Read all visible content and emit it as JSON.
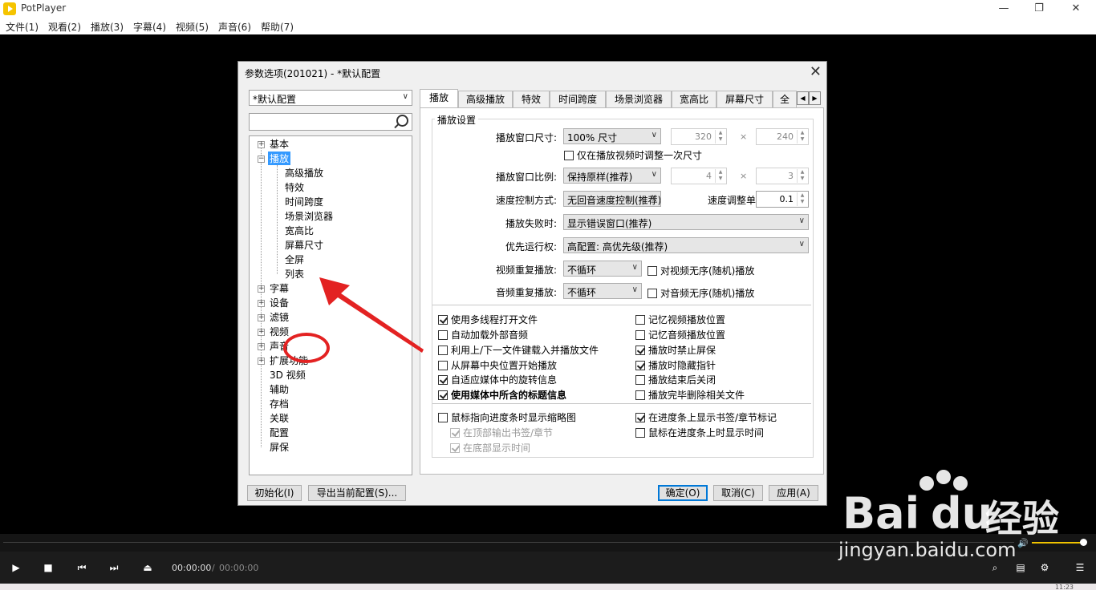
{
  "app": {
    "title": "PotPlayer",
    "menus": [
      "文件(1)",
      "观看(2)",
      "播放(3)",
      "字幕(4)",
      "视频(5)",
      "声音(6)",
      "帮助(7)"
    ]
  },
  "dialog": {
    "title": "参数选项(201021) - *默认配置",
    "profile_value": "*默认配置",
    "tree": {
      "basic": "基本",
      "playback": "播放",
      "children": [
        "高级播放",
        "特效",
        "时间跨度",
        "场景浏览器",
        "宽高比",
        "屏幕尺寸",
        "全屏",
        "列表"
      ],
      "after": [
        "字幕",
        "设备",
        "滤镜",
        "视频",
        "声音",
        "扩展功能"
      ],
      "plain": [
        "3D 视频",
        "辅助",
        "存档",
        "关联",
        "配置",
        "屏保"
      ]
    },
    "tabs": [
      "播放",
      "高级播放",
      "特效",
      "时间跨度",
      "场景浏览器",
      "宽高比",
      "屏幕尺寸",
      "全"
    ],
    "group_title": "播放设置",
    "window_size": {
      "label": "播放窗口尺寸:",
      "value": "100% 尺寸",
      "w": "320",
      "h": "240",
      "x": "×"
    },
    "resize_once": "仅在播放视频时调整一次尺寸",
    "window_ratio": {
      "label": "播放窗口比例:",
      "value": "保持原样(推荐)",
      "a": "4",
      "b": "3"
    },
    "speed_mode": {
      "label": "速度控制方式:",
      "value": "无回音速度控制(推荐)"
    },
    "speed_unit": {
      "label": "速度调整单位:",
      "value": "0.1"
    },
    "fail": {
      "label": "播放失败时:",
      "value": "显示错误窗口(推荐)"
    },
    "priority": {
      "label": "优先运行权:",
      "value": "高配置: 高优先级(推荐)"
    },
    "video_repeat": {
      "label": "视频重复播放:",
      "value": "不循环",
      "shuffle": "对视频无序(随机)播放"
    },
    "audio_repeat": {
      "label": "音频重复播放:",
      "value": "不循环",
      "shuffle": "对音频无序(随机)播放"
    },
    "checks_left": [
      {
        "label": "使用多线程打开文件",
        "checked": true
      },
      {
        "label": "自动加载外部音频",
        "checked": false
      },
      {
        "label": "利用上/下一文件键载入并播放文件",
        "checked": false
      },
      {
        "label": "从屏幕中央位置开始播放",
        "checked": false
      },
      {
        "label": "自适应媒体中的旋转信息",
        "checked": true
      },
      {
        "label": "使用媒体中所含的标题信息",
        "checked": true
      }
    ],
    "checks_right": [
      {
        "label": "记忆视频播放位置",
        "checked": false
      },
      {
        "label": "记忆音频播放位置",
        "checked": false
      },
      {
        "label": "播放时禁止屏保",
        "checked": true
      },
      {
        "label": "播放时隐藏指针",
        "checked": true
      },
      {
        "label": "播放结束后关闭",
        "checked": false
      },
      {
        "label": "播放完毕删除相关文件",
        "checked": false
      }
    ],
    "thumb": "鼠标指向进度条时显示缩略图",
    "thumb_top": "在顶部输出书签/章节",
    "thumb_bottom": "在底部显示时间",
    "bookmark": "在进度条上显示书签/章节标记",
    "hover_time": "鼠标在进度条上时显示时间",
    "buttons": {
      "reset": "初始化(I)",
      "export": "导出当前配置(S)...",
      "ok": "确定(O)",
      "cancel": "取消(C)",
      "apply": "应用(A)"
    }
  },
  "player": {
    "current_time": "00:00:00",
    "separator": "/",
    "total_time": "00:00:00",
    "clock": "11:23"
  },
  "watermark": {
    "brand": "Bai",
    "du": "du",
    "cn": "经验",
    "url": "jingyan.baidu.com"
  },
  "colors": {
    "accent": "#3399ff",
    "annotation": "#e32222",
    "volume": "#f0c300"
  }
}
